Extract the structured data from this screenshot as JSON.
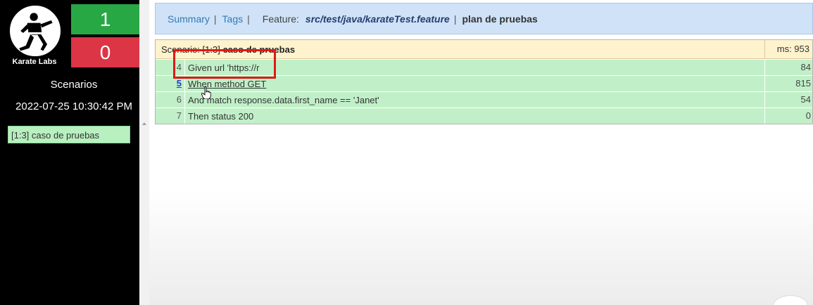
{
  "sidebar": {
    "logo_text": "Karate Labs",
    "passed_count": "1",
    "failed_count": "0",
    "scenarios_title": "Scenarios",
    "timestamp": "2022-07-25 10:30:42 PM",
    "nav_items": [
      {
        "label": "[1:3] caso de pruebas"
      }
    ]
  },
  "header": {
    "summary_link": "Summary",
    "tags_link": "Tags",
    "separator": "|",
    "feature_label": "Feature:",
    "feature_path": "src/test/java/karateTest.feature",
    "feature_name": "plan de pruebas"
  },
  "scenario": {
    "id": "Scenario: [1:3]",
    "name": "caso de pruebas",
    "ms_label": "ms: 953"
  },
  "steps": [
    {
      "line": "4",
      "text": "Given url 'https://r",
      "duration": "84"
    },
    {
      "line": "5",
      "text": "When method GET",
      "duration": "815"
    },
    {
      "line": "6",
      "text": "And match response.data.first_name == 'Janet'",
      "duration": "54"
    },
    {
      "line": "7",
      "text": "Then status 200",
      "duration": "0"
    }
  ],
  "colors": {
    "passed": "#28a745",
    "failed": "#dc3545",
    "step_pass_bg": "#c1f0c8",
    "scenario_bg": "#fff3cd",
    "header_bg": "#cfe2f7",
    "highlight": "#e01818"
  },
  "icons": {
    "logo": "karate-fighter-icon",
    "cursor": "hand-pointer-icon"
  }
}
